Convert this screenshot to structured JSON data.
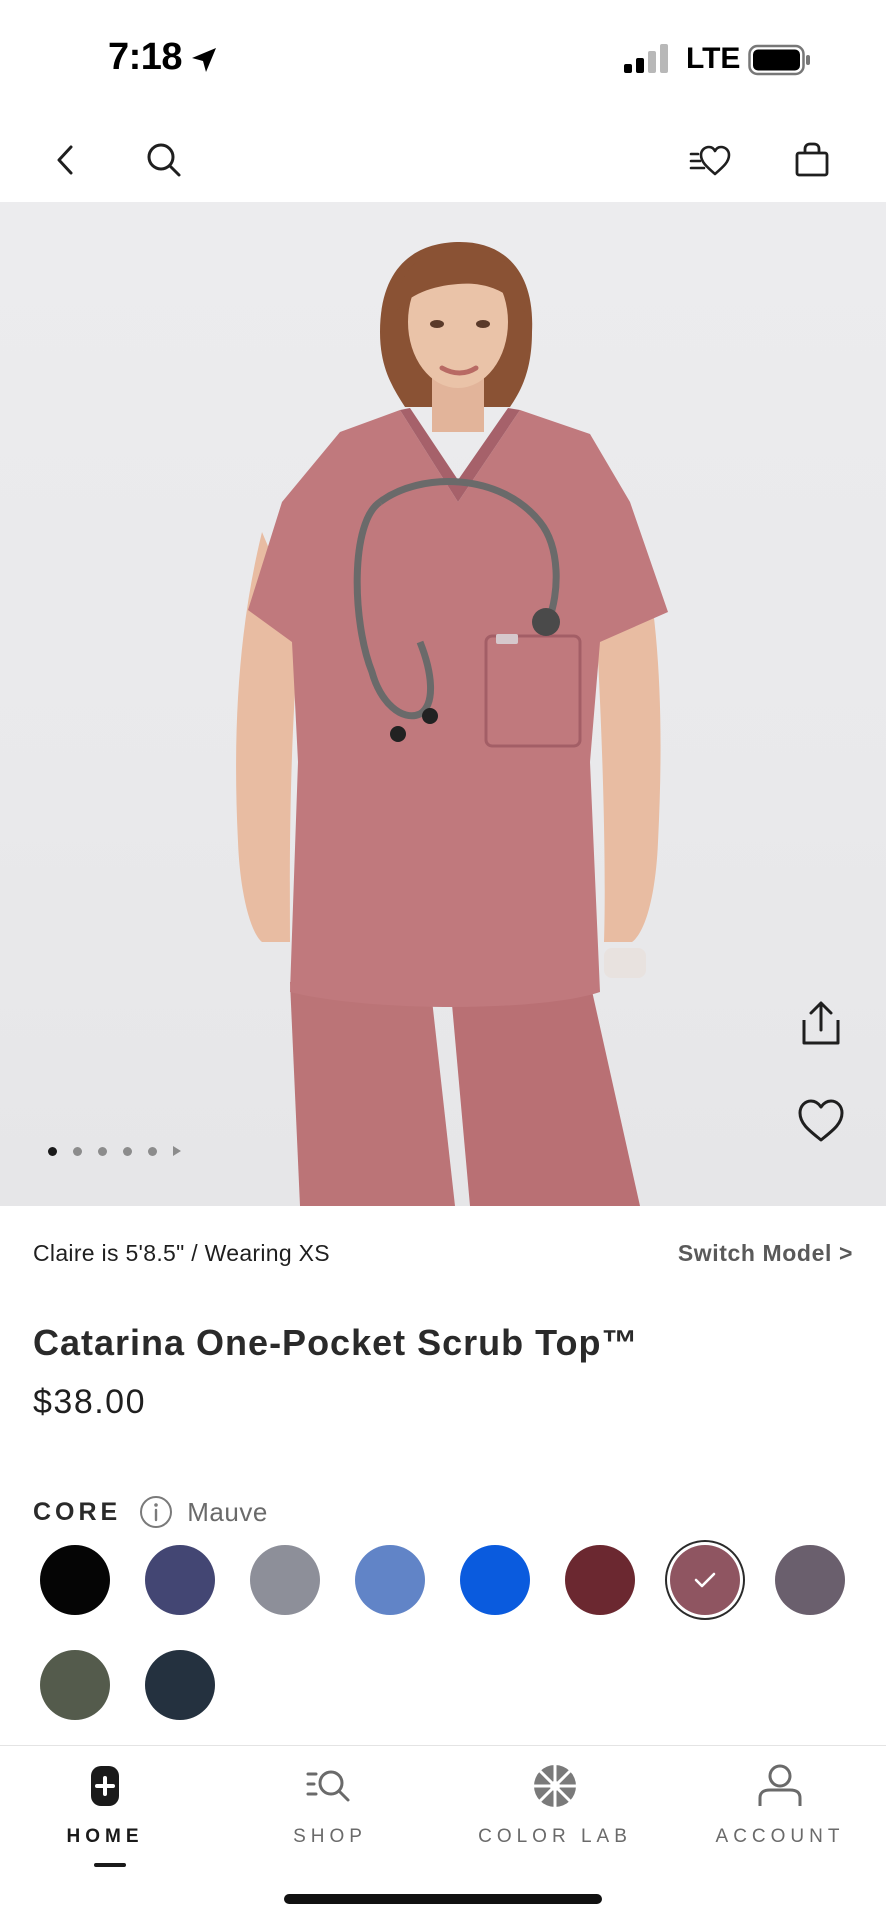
{
  "status_bar": {
    "time": "7:18",
    "network": "LTE"
  },
  "nav": {
    "back_icon": "chevron-left-icon",
    "search_icon": "search-icon",
    "wishlist_icon": "wishlist-heart-icon",
    "bag_icon": "shopping-bag-icon"
  },
  "gallery": {
    "image_count": 5,
    "active_index": 0,
    "share_icon": "share-icon",
    "favorite_icon": "heart-icon"
  },
  "model": {
    "info": "Claire is 5'8.5\" / Wearing XS",
    "switch_label": "Switch Model >"
  },
  "product": {
    "name": "Catarina One-Pocket Scrub Top™",
    "price": "$38.00"
  },
  "colors": {
    "group_label": "CORE",
    "selected_name": "Mauve",
    "swatches": [
      {
        "color": "#050505",
        "selected": false
      },
      {
        "color": "#434673",
        "selected": false
      },
      {
        "color": "#8d8f99",
        "selected": false
      },
      {
        "color": "#6184c7",
        "selected": false
      },
      {
        "color": "#0a5bde",
        "selected": false
      },
      {
        "color": "#6b2830",
        "selected": false
      },
      {
        "color": "#8f5561",
        "selected": true
      },
      {
        "color": "#6a5f6d",
        "selected": false
      },
      {
        "color": "#545b4c",
        "selected": false
      },
      {
        "color": "#24313f",
        "selected": false
      }
    ]
  },
  "tabs": [
    {
      "label": "HOME",
      "icon": "home-plus-icon",
      "active": true
    },
    {
      "label": "SHOP",
      "icon": "shop-search-icon",
      "active": false
    },
    {
      "label": "COLOR LAB",
      "icon": "color-wheel-icon",
      "active": false
    },
    {
      "label": "ACCOUNT",
      "icon": "account-person-icon",
      "active": false
    }
  ],
  "accent_color": "#1a1a1a"
}
